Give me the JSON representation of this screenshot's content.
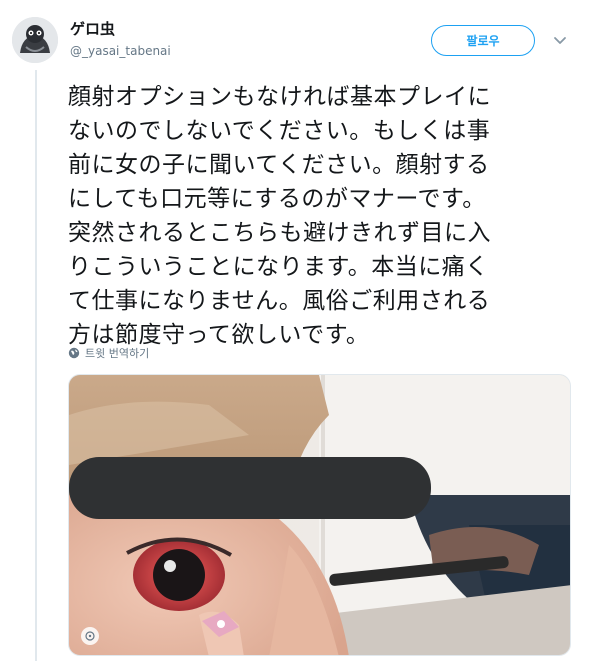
{
  "user": {
    "display_name": "ゲロ虫",
    "handle": "@_yasai_tabenai"
  },
  "follow_button": {
    "label": "팔로우"
  },
  "tweet": {
    "text": "顔射オプションもなければ基本プレイに\nないのでしないでください。もしくは事\n前に女の子に聞いてください。顔射する\nにしても口元等にするのがマナーです。\n突然されるとこちらも避けきれず目に入\nりこういうことになります。本当に痛く\nて仕事になりません。風俗ご利用される\n方は節度守って欲しいです。"
  },
  "translate": {
    "label": "트윗 번역하기",
    "icon": "globe-icon"
  },
  "media": {
    "description_icon": "gif-badge-icon"
  },
  "colors": {
    "accent": "#1da1f2",
    "secondary_text": "#657786",
    "divider": "#e1e8ed"
  }
}
